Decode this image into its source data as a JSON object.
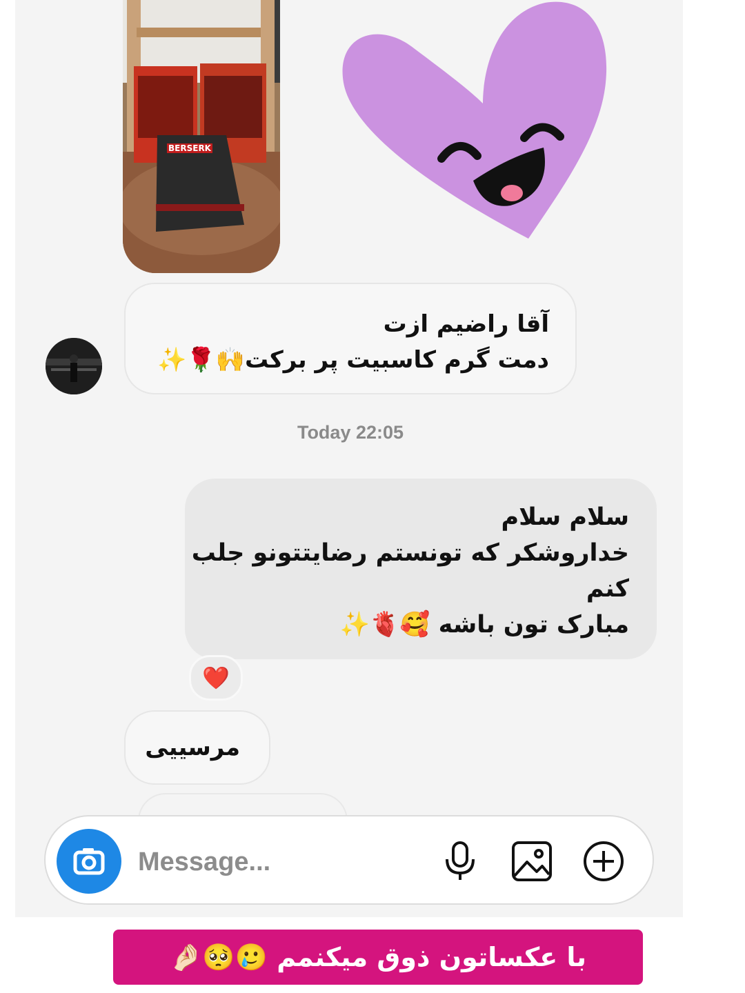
{
  "thread": {
    "shared_photo": {
      "book_title": "BERSERK"
    },
    "sticker": {
      "icon": "smiling-purple-heart-sticker",
      "color": "#cb92e0"
    },
    "received_message_1": {
      "line1": "آقا راضیم ازت",
      "line2": "دمت گرم کاسبیت پر برکت🙌🌹✨"
    },
    "timestamp": "Today 22:05",
    "sent_message": {
      "line1": "سلام سلام",
      "line2": "خداروشکر که تونستم رضایتتونو جلب",
      "line3": "کنم",
      "line4": "مبارک تون باشه 🥰🫀✨"
    },
    "reaction": "❤️",
    "received_message_2": {
      "text": "مرسییی"
    }
  },
  "composer": {
    "placeholder": "Message...",
    "camera_icon": "camera-icon",
    "mic_icon": "microphone-icon",
    "gallery_icon": "gallery-icon",
    "add_icon": "plus-circle-icon",
    "accent": "#1e88e5"
  },
  "caption": {
    "text": "با عکساتون ذوق میکنمم 🥲🥺🤌🏻",
    "background": "#d4147e"
  }
}
